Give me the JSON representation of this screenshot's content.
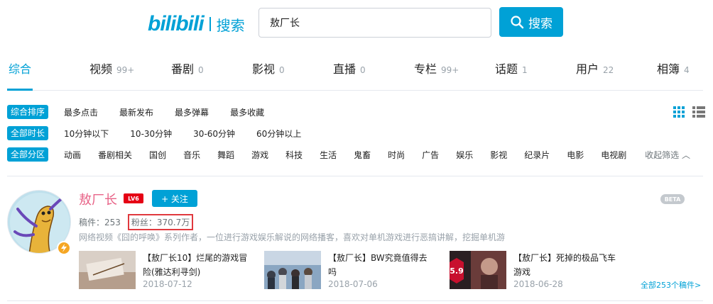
{
  "header": {
    "logo_text": "bilibili",
    "logo_search_label": "搜索",
    "query": "敖厂长",
    "search_button": "搜索"
  },
  "tabs": [
    {
      "label": "综合",
      "count": "",
      "active": true
    },
    {
      "label": "视频",
      "count": "99+"
    },
    {
      "label": "番剧",
      "count": "0"
    },
    {
      "label": "影视",
      "count": "0"
    },
    {
      "label": "直播",
      "count": "0"
    },
    {
      "label": "专栏",
      "count": "99+"
    },
    {
      "label": "话题",
      "count": "1"
    },
    {
      "label": "用户",
      "count": "22"
    },
    {
      "label": "相簿",
      "count": "4"
    }
  ],
  "filters": {
    "sort": {
      "tag": "综合排序",
      "options": [
        "最多点击",
        "最新发布",
        "最多弹幕",
        "最多收藏"
      ]
    },
    "duration": {
      "tag": "全部时长",
      "options": [
        "10分钟以下",
        "10-30分钟",
        "30-60分钟",
        "60分钟以上"
      ]
    },
    "zone": {
      "tag": "全部分区",
      "options": [
        "动画",
        "番剧相关",
        "国创",
        "音乐",
        "舞蹈",
        "游戏",
        "科技",
        "生活",
        "鬼畜",
        "时尚",
        "广告",
        "娱乐",
        "影视",
        "纪录片",
        "电影",
        "电视剧"
      ]
    },
    "collapse_label": "收起筛选"
  },
  "user": {
    "name": "敖厂长",
    "level": "LV6",
    "follow_label": "+ 关注",
    "beta": "BETA",
    "uploads_text": "稿件：253",
    "fans_text": "粉丝：370.7万",
    "description": "网络视频《囧的呼唤》系列作者，一位进行游戏娱乐解说的网络播客，喜欢对单机游戏进行恶搞讲解，挖掘单机游",
    "videos": [
      {
        "title": "【敖厂长10】烂尾的游戏冒险(雅达利寻剑)",
        "date": "2018-07-12"
      },
      {
        "title": "【敖厂长】BW究竟值得去吗",
        "date": "2018-07-06"
      },
      {
        "title": "【敖厂长】死掉的极品飞车游戏",
        "date": "2018-06-28",
        "score": "5.9"
      }
    ],
    "all_link": "全部253个稿件>"
  },
  "colors": {
    "accent": "#00a1d6",
    "name_pink": "#e86488",
    "level_red": "#e50014",
    "highlight_box": "#e0393e"
  }
}
